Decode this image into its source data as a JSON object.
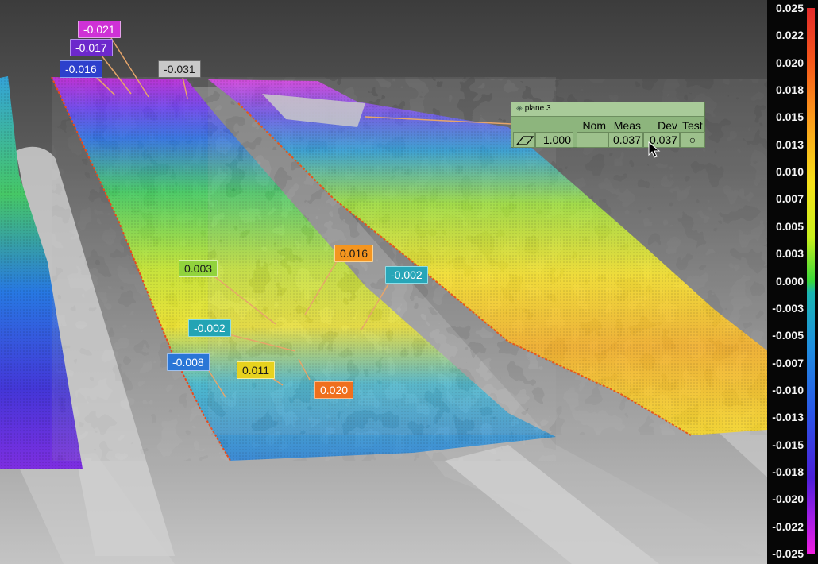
{
  "callouts": [
    {
      "id": "c-021",
      "value": "-0.021",
      "bg": "#cf31d6",
      "border": "#e6a1eb",
      "fg": "#ffffff"
    },
    {
      "id": "c-017",
      "value": "-0.017",
      "bg": "#6d28cc",
      "border": "#b693ee",
      "fg": "#ffffff"
    },
    {
      "id": "c-016",
      "value": "-0.016",
      "bg": "#2d40cc",
      "border": "#8f9ff0",
      "fg": "#ffffff"
    },
    {
      "id": "c-031",
      "value": "-0.031",
      "bg": "#c9c9c9",
      "border": "#6b6b6b",
      "fg": "#1a1a1a"
    },
    {
      "id": "c-003",
      "value": "0.003",
      "bg": "#91d33d",
      "border": "#d9f0b0",
      "fg": "#1a1a1a"
    },
    {
      "id": "c-016b",
      "value": "0.016",
      "bg": "#f4951f",
      "border": "#fbd392",
      "fg": "#1a1a1a"
    },
    {
      "id": "c-002a",
      "value": "-0.002",
      "bg": "#28a6b8",
      "border": "#8fdde7",
      "fg": "#ffffff"
    },
    {
      "id": "c-002b",
      "value": "-0.002",
      "bg": "#23a4b4",
      "border": "#8fdde7",
      "fg": "#ffffff"
    },
    {
      "id": "c-008",
      "value": "-0.008",
      "bg": "#2a76d6",
      "border": "#9ec1ef",
      "fg": "#ffffff"
    },
    {
      "id": "c-011",
      "value": "0.011",
      "bg": "#e7d21e",
      "border": "#f6ee9c",
      "fg": "#1a1a1a"
    },
    {
      "id": "c-020",
      "value": "0.020",
      "bg": "#ef6f1d",
      "border": "#f8bc8e",
      "fg": "#ffffff"
    }
  ],
  "plane_panel": {
    "title": "plane 3",
    "headers": {
      "nom": "Nom",
      "meas": "Meas",
      "dev": "Dev",
      "test": "Test"
    },
    "row": {
      "size": "1.000",
      "nom": "",
      "meas": "0.037",
      "dev": "0.037",
      "test_symbol": "○"
    }
  },
  "color_legend": {
    "ticks": [
      "0.025",
      "0.022",
      "0.020",
      "0.018",
      "0.015",
      "0.013",
      "0.010",
      "0.007",
      "0.005",
      "0.003",
      "0.000",
      "-0.003",
      "-0.005",
      "-0.007",
      "-0.010",
      "-0.013",
      "-0.015",
      "-0.018",
      "-0.020",
      "-0.022",
      "-0.025"
    ]
  },
  "icons": {
    "plane": "plane-icon",
    "cursor": "arrow-cursor-icon",
    "test": "circle-status-icon"
  }
}
